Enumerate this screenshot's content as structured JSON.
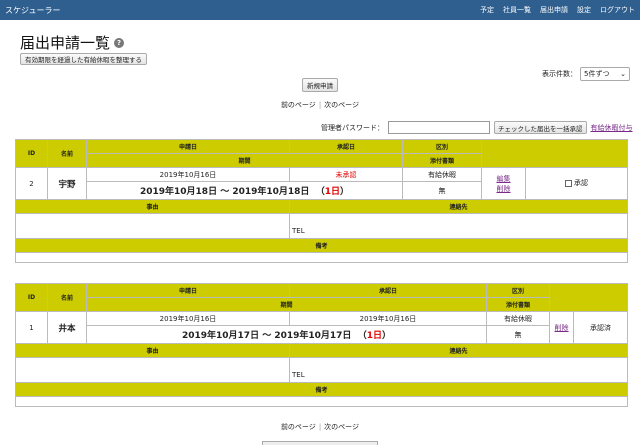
{
  "header": {
    "app_title": "スケジューラー",
    "nav": [
      "予定",
      "社員一覧",
      "届出申請",
      "設定",
      "ログアウト"
    ]
  },
  "page": {
    "title": "届出申請一覧",
    "help_icon": "?",
    "cleanup_button": "有効期限を経過した有給休暇を整理する",
    "perpage_label": "表示件数：",
    "perpage_value": "5件ずつ",
    "new_button": "新規申請",
    "prev": "前のページ",
    "next": "次のページ",
    "admin_pw_label": "管理者パスワード：",
    "bulk_button": "チェックした届出を一括承認",
    "grant_link": "有給休暇付与"
  },
  "headers": {
    "id": "ID",
    "name": "名前",
    "apply_date": "申請日",
    "approve_date": "承認日",
    "type": "区別",
    "period": "期間",
    "attachment": "添付書類",
    "reason": "事由",
    "contact": "連絡先",
    "notes": "備考"
  },
  "records": [
    {
      "id": "2",
      "name": "宇野",
      "apply_date": "2019年10月16日",
      "approve_date": "未承認",
      "type": "有給休暇",
      "attachment": "無",
      "period_text": "2019年10月18日 ～ 2019年10月18日",
      "days_open": "（",
      "days": "1日",
      "days_close": "）",
      "edit": "編集",
      "delete": "削除",
      "approve_label": "承認",
      "reason": "",
      "contact": "TEL",
      "notes": ""
    },
    {
      "id": "1",
      "name": "井本",
      "apply_date": "2019年10月16日",
      "approve_date": "2019年10月16日",
      "type": "有給休暇",
      "attachment": "無",
      "period_text": "2019年10月17日 ～ 2019年10月17日",
      "days_open": "（",
      "days": "1日",
      "days_close": "）",
      "delete": "削除",
      "status": "承認済",
      "reason": "",
      "contact": "TEL",
      "notes": ""
    }
  ]
}
